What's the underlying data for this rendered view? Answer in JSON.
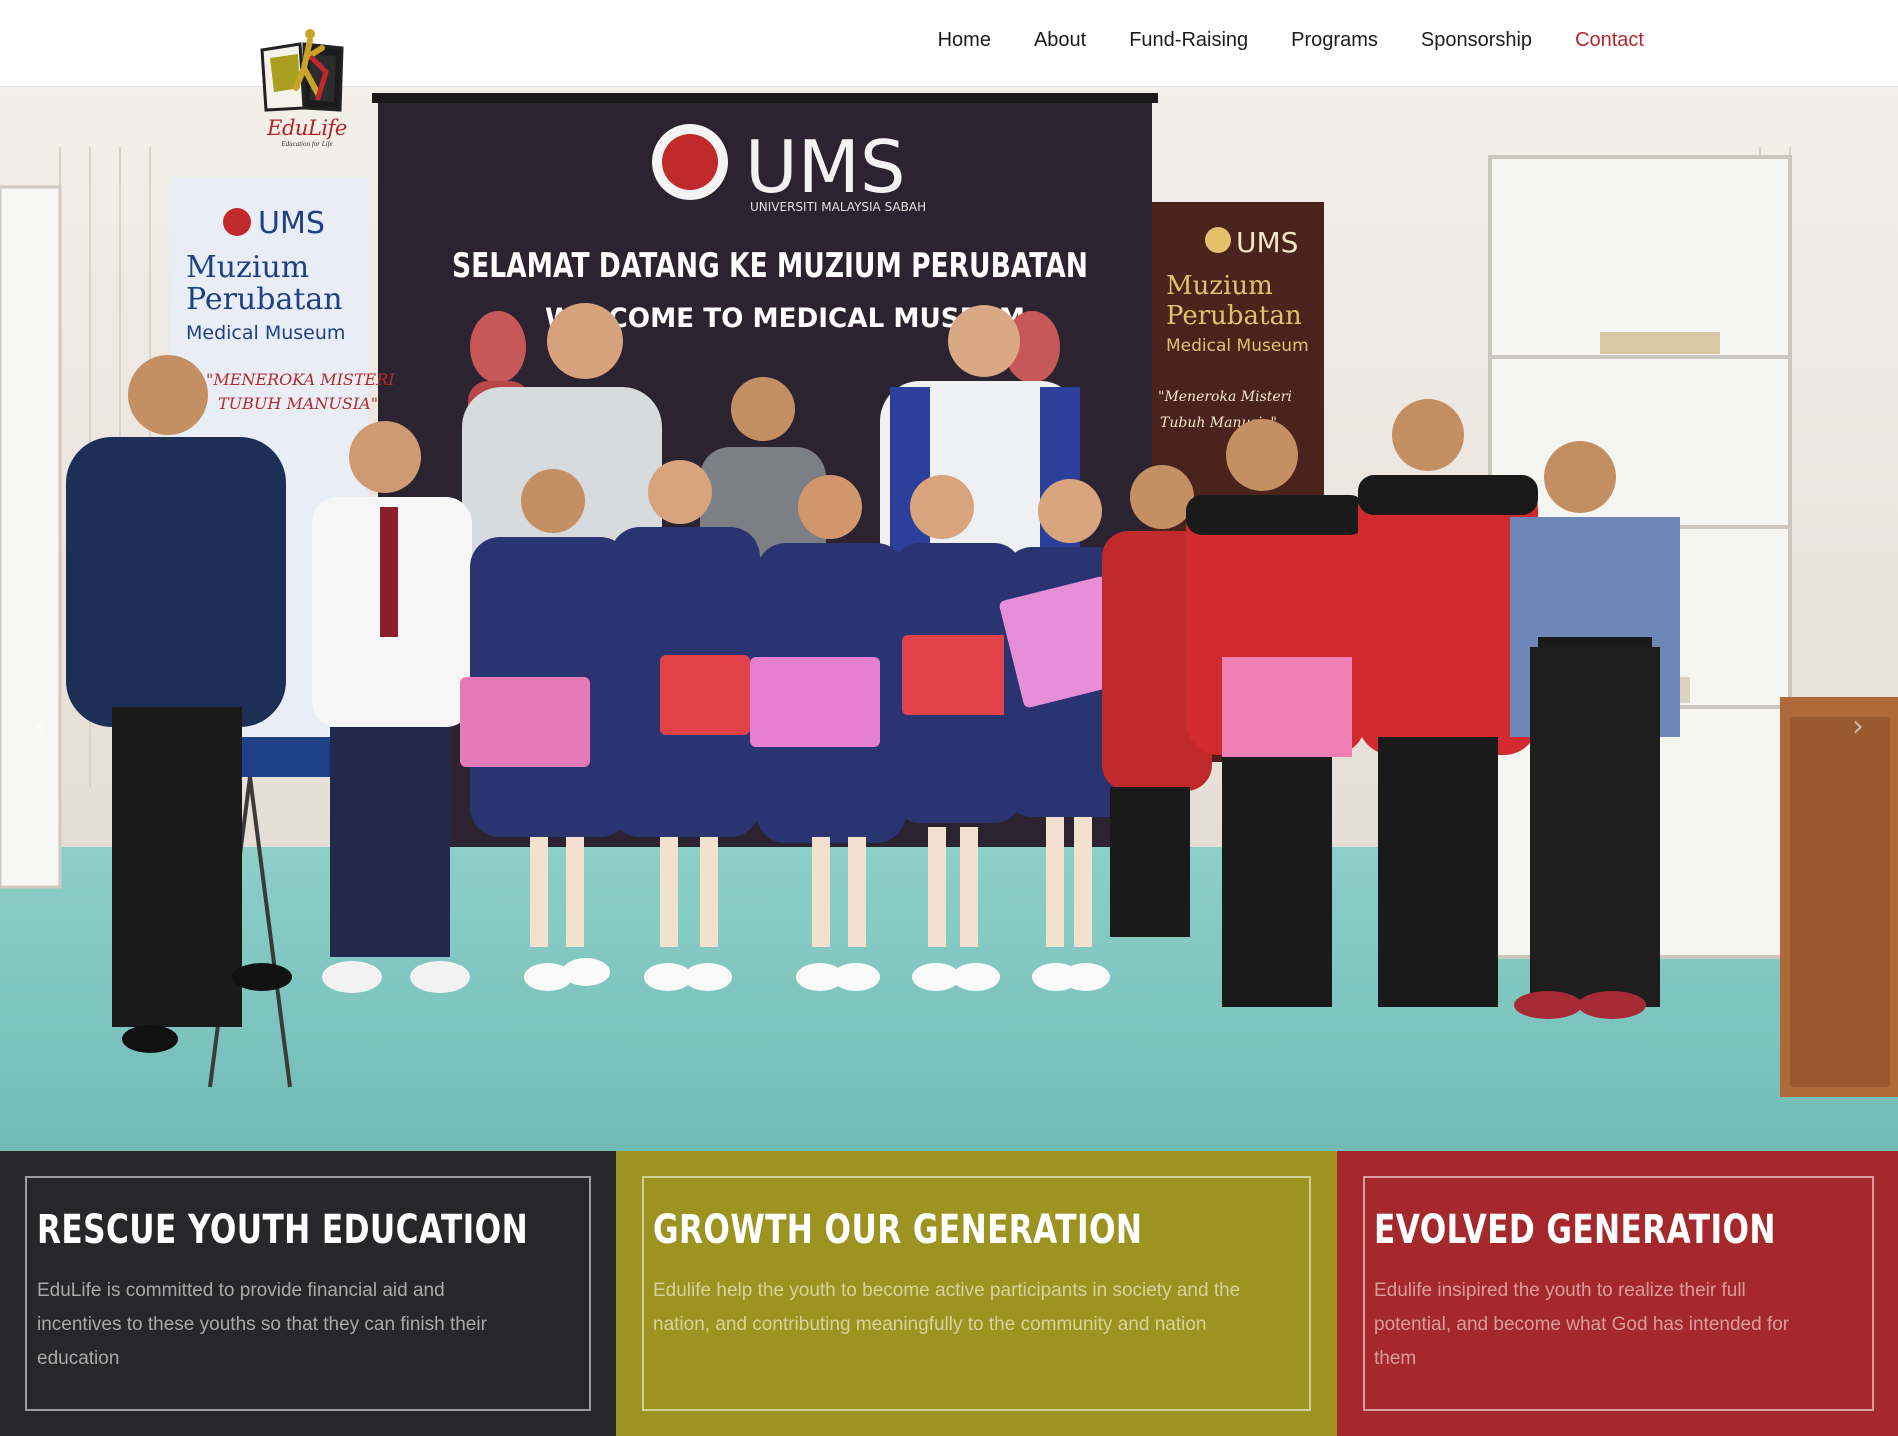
{
  "header": {
    "logo": {
      "name": "EduLife",
      "tagline": "Education for Life"
    },
    "nav": [
      {
        "label": "Home",
        "active": false
      },
      {
        "label": "About",
        "active": false
      },
      {
        "label": "Fund-Raising",
        "active": false
      },
      {
        "label": "Programs",
        "active": false
      },
      {
        "label": "Sponsorship",
        "active": false
      },
      {
        "label": "Contact",
        "active": true
      }
    ],
    "active_color": "#b3272d"
  },
  "hero": {
    "banner": {
      "logo_text": "UMS",
      "subtitle": "UNIVERSITI MALAYSIA SABAH",
      "line1": "SELAMAT DATANG KE MUZIUM PERUBATAN",
      "line2": "WELCOME TO MEDICAL MUSEUM"
    },
    "left_standee": {
      "logo_text": "UMS",
      "title1": "Muzium",
      "title2": "Perubatan",
      "title3": "Medical Museum",
      "slogan1": "\"MENEROKA MISTERI",
      "slogan2": "TUBUH MANUSIA\""
    },
    "right_standee": {
      "logo_text": "UMS",
      "title1": "Muzium",
      "title2": "Perubatan",
      "title3": "Medical Museum",
      "slogan1": "\"Meneroka Misteri",
      "slogan2": "Tubuh Manusia\""
    },
    "prev_icon": "chevron-left-icon",
    "next_icon": "chevron-right-icon"
  },
  "features": [
    {
      "title": "RESCUE YOUTH EDUCATION",
      "text": "EduLife is committed to provide financial aid and incentives to these youths so that they can finish their education",
      "color": "#27272a"
    },
    {
      "title": "GROWTH OUR GENERATION",
      "text": "Edulife help the youth to become active participants in society and the nation, and contributing meaningfully to the community and nation",
      "color": "#9c9321"
    },
    {
      "title": "EVOLVED GENERATION",
      "text": "Edulife insipired the youth to realize their full potential, and become what God has intended for them",
      "color": "#a5292c"
    }
  ]
}
